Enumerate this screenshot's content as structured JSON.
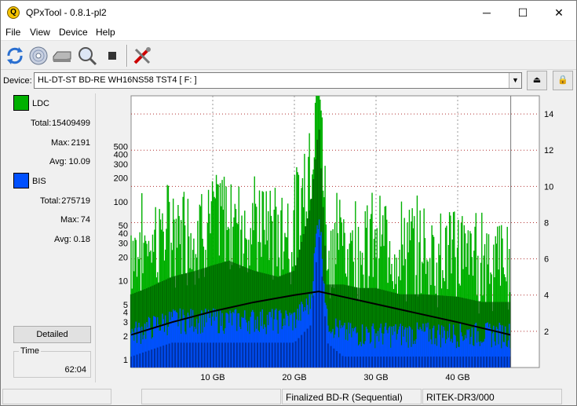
{
  "window": {
    "title": "QPxTool - 0.8.1-pl2",
    "app_icon_letter": "Q",
    "minimize": "─",
    "maximize": "☐",
    "close": "✕"
  },
  "menu": [
    "File",
    "View",
    "Device",
    "Help"
  ],
  "toolbar": {
    "icons": [
      "refresh-icon",
      "disc-icon",
      "drive-icon",
      "scan-icon",
      "stop-icon",
      "tools-icon"
    ]
  },
  "device": {
    "label": "Device:",
    "value": "HL-DT-ST BD-RE  WH16NS58  TST4 [ F: ]",
    "arrow": "▼",
    "eject": "⏏",
    "lock": "🔒"
  },
  "stats": {
    "ldc": {
      "name": "LDC",
      "color": "#00b000",
      "total_label": "Total:",
      "total": "15409499",
      "max_label": "Max:",
      "max": "2191",
      "avg_label": "Avg:",
      "avg": "10.09"
    },
    "bis": {
      "name": "BIS",
      "color": "#0050ff",
      "total_label": "Total:",
      "total": "275719",
      "max_label": "Max:",
      "max": "74",
      "avg_label": "Avg:",
      "avg": "0.18"
    }
  },
  "detailed_label": "Detailed",
  "time": {
    "label": "Time",
    "value": "62:04"
  },
  "chart_data": {
    "type": "area",
    "x_ticks": [
      "10 GB",
      "20 GB",
      "30 GB",
      "40 GB"
    ],
    "x_tick_values": [
      10,
      20,
      30,
      40
    ],
    "xlim": [
      0,
      50
    ],
    "y_left_ticks": [
      "1",
      "2",
      "3",
      "4",
      "5",
      "10",
      "20",
      "30",
      "40",
      "50",
      "100",
      "200",
      "300",
      "400",
      "500"
    ],
    "y_left_values": [
      1,
      2,
      3,
      4,
      5,
      10,
      20,
      30,
      40,
      50,
      100,
      200,
      300,
      400,
      500
    ],
    "y_left_scale": "log",
    "ylim_left": [
      0.8,
      2191
    ],
    "y_right_ticks": [
      "2",
      "4",
      "6",
      "8",
      "10",
      "12",
      "14"
    ],
    "y_right_values": [
      2,
      4,
      6,
      8,
      10,
      12,
      14
    ],
    "ylim_right": [
      0,
      15
    ],
    "data_end_gb": 46.5,
    "series": [
      {
        "name": "LDC",
        "color": "#00b000",
        "x": [
          0,
          2,
          5,
          8,
          10,
          12,
          15,
          18,
          20,
          22,
          23,
          24,
          26,
          28,
          30,
          33,
          36,
          40,
          43,
          46
        ],
        "values": [
          15,
          18,
          25,
          30,
          35,
          40,
          30,
          25,
          30,
          200,
          2191,
          20,
          20,
          18,
          18,
          15,
          15,
          14,
          12,
          12
        ]
      },
      {
        "name": "BIS",
        "color": "#0050ff",
        "x": [
          0,
          5,
          10,
          15,
          20,
          22,
          23,
          24,
          26,
          30,
          35,
          40,
          46
        ],
        "values": [
          2,
          3,
          3,
          3,
          3,
          5,
          74,
          3,
          2,
          2,
          2,
          2,
          2
        ]
      },
      {
        "name": "Speed",
        "color": "#000000",
        "x": [
          0,
          5,
          10,
          15,
          20,
          23,
          26,
          30,
          35,
          40,
          46.5
        ],
        "values": [
          1.8,
          2.5,
          3.1,
          3.6,
          4.0,
          4.2,
          3.9,
          3.5,
          3.0,
          2.5,
          1.8
        ]
      }
    ]
  },
  "status": {
    "pane1": "",
    "pane2": "",
    "media": "Finalized BD-R (Sequential)",
    "mid": "RITEK-DR3/000"
  }
}
